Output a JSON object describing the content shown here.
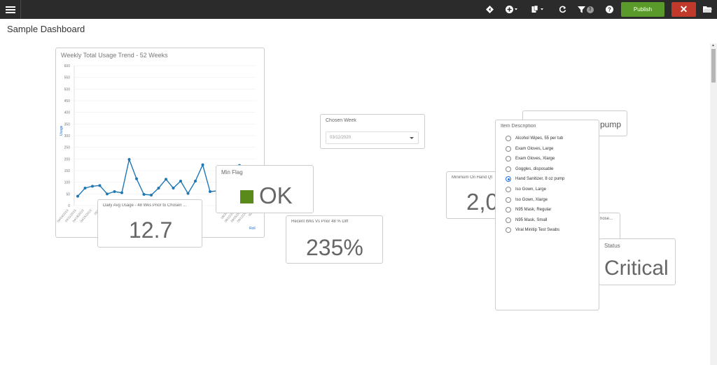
{
  "toolbar": {
    "publish_label": "Publish",
    "close_label": "✕",
    "filter_count": "3",
    "icons": [
      "menu-icon",
      "diamond-icon",
      "add-icon",
      "copy-icon",
      "refresh-icon",
      "filter-icon",
      "help-icon",
      "folder-icon"
    ]
  },
  "page": {
    "title": "Sample Dashboard"
  },
  "trend_card": {
    "title": "Weekly Total Usage Trend - 52 Weeks",
    "ylabel": "Usage",
    "xlabel_fragment": "Roll",
    "x_ticks": [
      "04/04/2019",
      "04/11/2019",
      "04/18/2019",
      "04/25/2019",
      "05/0"
    ],
    "x_ticks_right": [
      "08/2019",
      "08/22/2019",
      "09/05/2019",
      "09/12/2019",
      "09/26"
    ]
  },
  "chart_data": {
    "type": "line",
    "title": "Weekly Total Usage Trend - 52 Weeks",
    "ylabel": "Usage",
    "ylim": [
      0,
      600
    ],
    "y_ticks": [
      "0",
      "50",
      "100",
      "150",
      "200",
      "250",
      "300",
      "350",
      "400",
      "450",
      "500",
      "550",
      "600"
    ],
    "series": [
      {
        "values": [
          40,
          75,
          83,
          86,
          50,
          60,
          55,
          198,
          115,
          48,
          45,
          75,
          113,
          75,
          105,
          52,
          105,
          175,
          60,
          63,
          65,
          90,
          172
        ]
      }
    ],
    "color": "#1f77b4",
    "grid": true
  },
  "daily_avg_card": {
    "title": "Daily Avg Usage - 48 Wks Prior to Chosen ...",
    "value": "12.7"
  },
  "min_flag_card": {
    "title": "Min Flag",
    "value": "OK",
    "color": "#5a8a1a"
  },
  "recent_card": {
    "title": "Recent Wks Vs Prior 48 % Diff",
    "value": "235%"
  },
  "chosen_week_card": {
    "title": "Chosen Week",
    "value": "03/12/2020"
  },
  "min_on_hand_card": {
    "title": "Minimum On Hand Qt",
    "value": "2,0"
  },
  "pump_card": {
    "value": "pump"
  },
  "hidden_card": {
    "title": "hose..."
  },
  "status_card": {
    "title": "Status",
    "value": "Critical"
  },
  "item_card": {
    "title": "Item Description",
    "items": [
      {
        "label": "Alcohol Wipes, 55 per tub",
        "checked": false
      },
      {
        "label": "Exam Gloves, Large",
        "checked": false
      },
      {
        "label": "Exam Gloves, Xlarge",
        "checked": false
      },
      {
        "label": "Goggles, disposable",
        "checked": false
      },
      {
        "label": "Hand Sanitizer, 8 oz pump",
        "checked": true
      },
      {
        "label": "Iso Gown, Large",
        "checked": false
      },
      {
        "label": "Iso Gown, Xlarge",
        "checked": false
      },
      {
        "label": "N95 Mask, Regular",
        "checked": false
      },
      {
        "label": "N95 Mask, Small",
        "checked": false
      },
      {
        "label": "Viral Minitip Test Swabs",
        "checked": false
      }
    ]
  }
}
